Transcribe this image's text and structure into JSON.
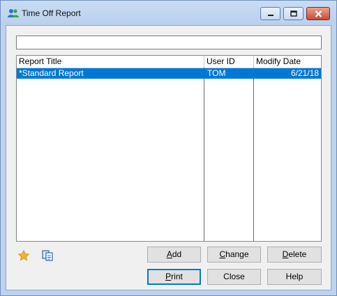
{
  "window": {
    "title": "Time Off Report"
  },
  "search": {
    "value": "",
    "placeholder": ""
  },
  "list": {
    "columns": [
      "Report Title",
      "User ID",
      "Modify Date"
    ],
    "rows": [
      {
        "title": "*Standard Report",
        "user_id": "TOM",
        "modify_date": "6/21/18",
        "selected": true
      }
    ]
  },
  "toolbar": {
    "favorite_icon": "star-icon",
    "copy_icon": "copy-icon"
  },
  "buttons": {
    "add": {
      "mnemonic": "A",
      "rest": "dd"
    },
    "change": {
      "mnemonic": "C",
      "rest": "hange"
    },
    "delete": {
      "mnemonic": "D",
      "rest": "elete"
    },
    "print": {
      "mnemonic": "P",
      "rest": "rint"
    },
    "close": "Close",
    "help": "Help"
  },
  "colors": {
    "selection": "#0078d7",
    "title_bar": "#bcd2ee",
    "close_button": "#c84a36",
    "star": "#f2b233"
  }
}
